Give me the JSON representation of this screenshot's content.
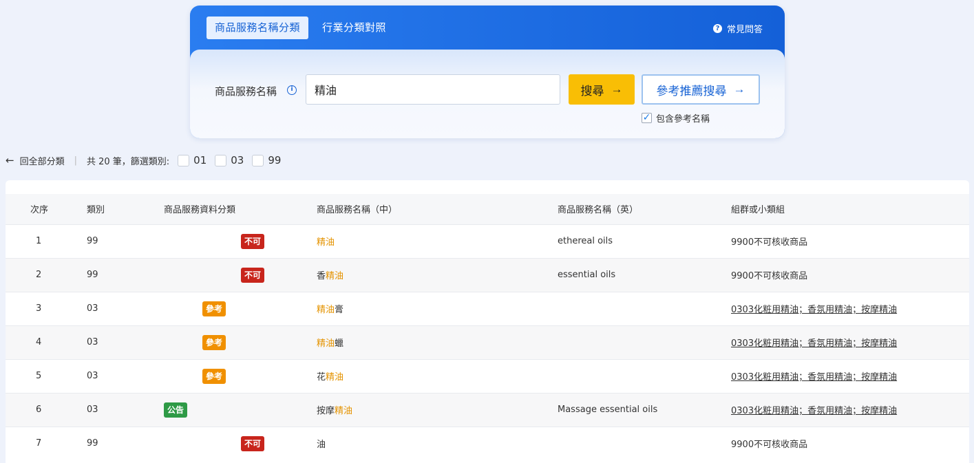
{
  "tabs": [
    {
      "label": "商品服務名稱分類",
      "active": true
    },
    {
      "label": "行業分類對照",
      "active": false
    }
  ],
  "faq_label": "常見問答",
  "search": {
    "field_label": "商品服務名稱",
    "value": "精油",
    "search_button": "搜尋",
    "ref_button": "參考推薦搜尋",
    "include_ref_label": "包含參考名稱",
    "include_ref_checked": true
  },
  "filter": {
    "back_label": "回全部分類",
    "count_text": "共 20 筆，篩選類別:",
    "categories": [
      "01",
      "03",
      "99"
    ]
  },
  "table": {
    "headers": [
      "次序",
      "類別",
      "商品服務資料分類",
      "商品服務名稱（中）",
      "商品服務名稱（英）",
      "組群或小類組"
    ],
    "rows": [
      {
        "seq": "1",
        "class": "99",
        "badge": "不可",
        "badge_type": "no",
        "zh_pre": "",
        "zh_hl": "精油",
        "zh_post": "",
        "en": "ethereal oils",
        "group": "9900不可核收商品",
        "group_link": false
      },
      {
        "seq": "2",
        "class": "99",
        "badge": "不可",
        "badge_type": "no",
        "zh_pre": "香",
        "zh_hl": "精油",
        "zh_post": "",
        "en": "essential oils",
        "group": "9900不可核收商品",
        "group_link": false
      },
      {
        "seq": "3",
        "class": "03",
        "badge": "參考",
        "badge_type": "ref",
        "zh_pre": "",
        "zh_hl": "精油",
        "zh_post": "膏",
        "en": "",
        "group": "0303化粧用精油；香氛用精油；按摩精油",
        "group_link": true
      },
      {
        "seq": "4",
        "class": "03",
        "badge": "參考",
        "badge_type": "ref",
        "zh_pre": "",
        "zh_hl": "精油",
        "zh_post": "蠟",
        "en": "",
        "group": "0303化粧用精油；香氛用精油；按摩精油",
        "group_link": true
      },
      {
        "seq": "5",
        "class": "03",
        "badge": "參考",
        "badge_type": "ref",
        "zh_pre": "花",
        "zh_hl": "精油",
        "zh_post": "",
        "en": "",
        "group": "0303化粧用精油；香氛用精油；按摩精油",
        "group_link": true
      },
      {
        "seq": "6",
        "class": "03",
        "badge": "公告",
        "badge_type": "ann",
        "zh_pre": "按摩",
        "zh_hl": "精油",
        "zh_post": "",
        "en": "Massage essential oils",
        "group": "0303化粧用精油；香氛用精油；按摩精油",
        "group_link": true
      },
      {
        "seq": "7",
        "class": "99",
        "badge": "不可",
        "badge_type": "no",
        "zh_pre": "油",
        "zh_hl": "",
        "zh_post": "",
        "en": "",
        "group": "9900不可核收商品",
        "group_link": false
      }
    ]
  },
  "colors": {
    "primary": "#1662d4",
    "search_button": "#f9be05",
    "highlight": "#e49300",
    "badge_no": "#c8251c",
    "badge_ref": "#f09000",
    "badge_ann": "#2e9a46"
  }
}
